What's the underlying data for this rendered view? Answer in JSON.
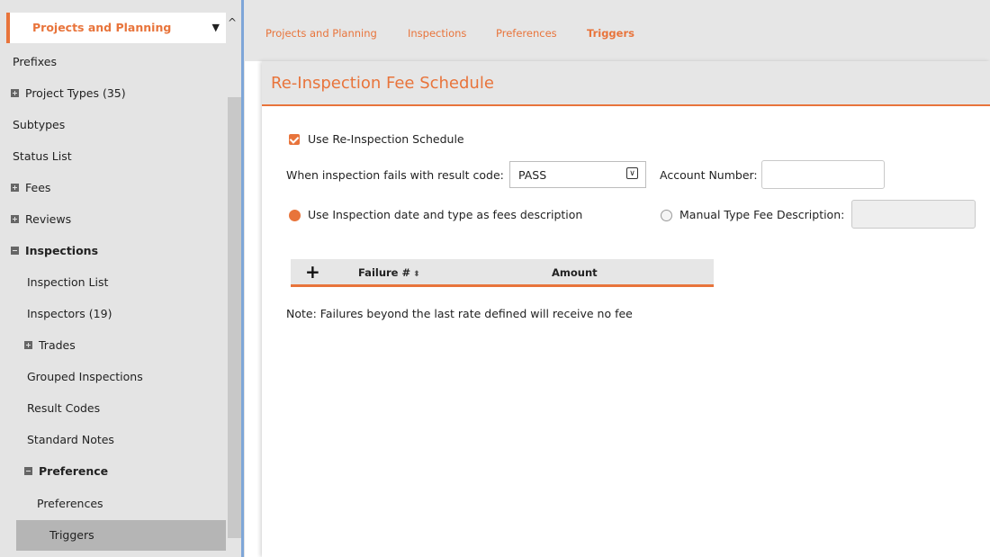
{
  "sidebar": {
    "header_label": "Projects and Planning",
    "items": [
      {
        "label": "Prefixes"
      },
      {
        "label": "Project Types (35)"
      },
      {
        "label": "Subtypes"
      },
      {
        "label": "Status List"
      },
      {
        "label": "Fees"
      },
      {
        "label": "Reviews"
      },
      {
        "label": "Inspections"
      },
      {
        "label": "Inspection List"
      },
      {
        "label": "Inspectors (19)"
      },
      {
        "label": "Trades"
      },
      {
        "label": "Grouped Inspections"
      },
      {
        "label": "Result Codes"
      },
      {
        "label": "Standard Notes"
      },
      {
        "label": "Preference"
      },
      {
        "label": "Preferences"
      },
      {
        "label": "Triggers"
      }
    ]
  },
  "tabs": [
    "Projects and Planning",
    "Inspections",
    "Preferences",
    "Triggers"
  ],
  "panel": {
    "title": "Re-Inspection Fee Schedule",
    "use_schedule_label": "Use Re-Inspection Schedule",
    "result_code_label": "When inspection fails with result code:",
    "result_code_value": "PASS",
    "account_number_label": "Account Number:",
    "radio_inspection_label": "Use Inspection date and type as fees description",
    "radio_manual_label": "Manual Type Fee Description:",
    "grid": {
      "columns": [
        "Failure #",
        "Amount"
      ]
    },
    "note": "Note: Failures beyond the last rate defined will receive no fee"
  },
  "colors": {
    "accent": "#e8743b",
    "sidebar_bg": "#e4e4e4",
    "divider": "#7ea6d8"
  }
}
